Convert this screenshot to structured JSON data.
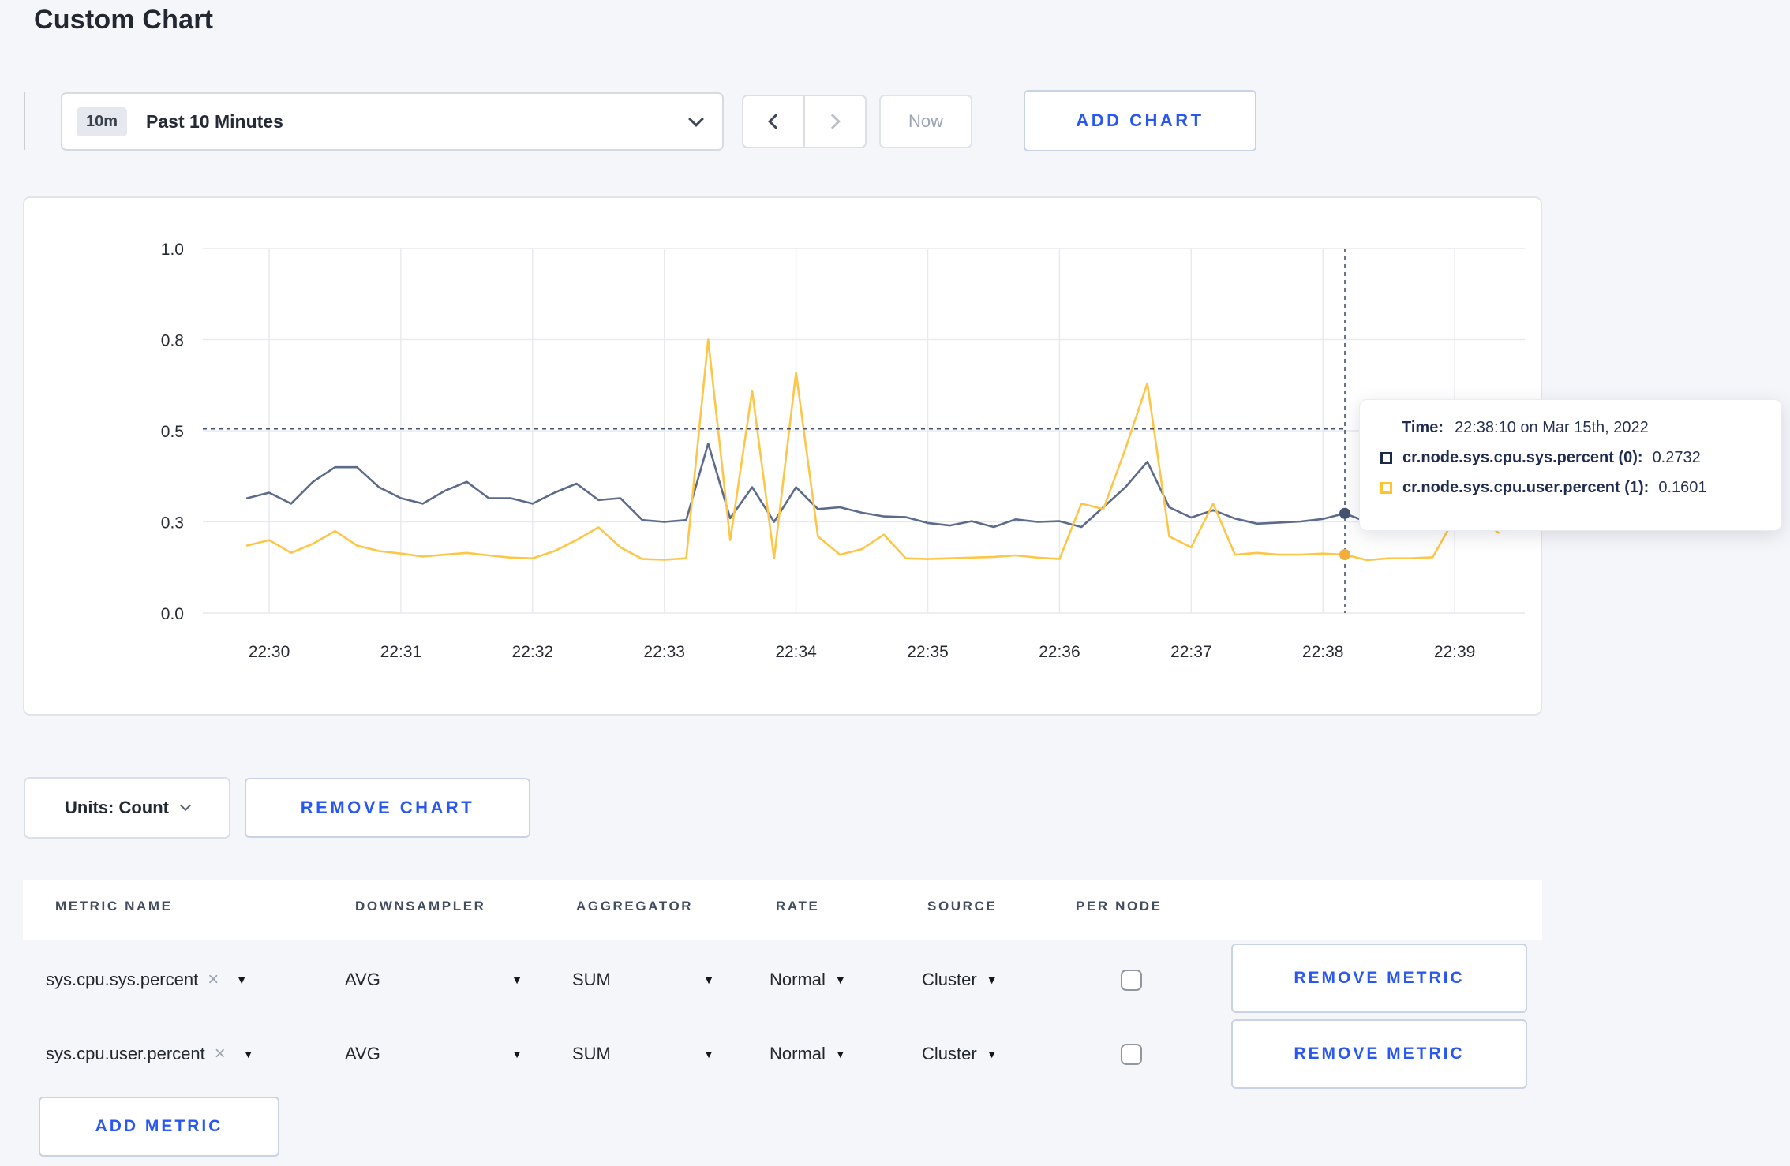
{
  "page": {
    "title": "Custom Chart"
  },
  "toolbar": {
    "time_badge": "10m",
    "time_label": "Past 10 Minutes",
    "now_label": "Now",
    "add_chart_label": "ADD CHART"
  },
  "colors": {
    "accent_blue": "#2a57f2",
    "series_sys": "#5c6b89",
    "series_user": "#fdc648",
    "crosshair": "#44536f",
    "page_bg": "#f5f6fa"
  },
  "chart_data": {
    "type": "line",
    "title": "",
    "xlabel": "",
    "ylabel": "",
    "ylim": [
      0,
      1
    ],
    "grid": true,
    "grid_color": "#e8eaee",
    "x_labels": [
      "22:30",
      "22:31",
      "22:32",
      "22:33",
      "22:34",
      "22:35",
      "22:36",
      "22:37",
      "22:38",
      "22:39"
    ],
    "step_min": 0.166667,
    "x_offset_steps": -1,
    "y_ticks": [
      {
        "v": 0.0,
        "label": "0.0"
      },
      {
        "v": 0.25,
        "label": "0.3"
      },
      {
        "v": 0.5,
        "label": "0.5"
      },
      {
        "v": 0.75,
        "label": "0.8"
      },
      {
        "v": 1.0,
        "label": "1.0"
      }
    ],
    "series": [
      {
        "name": "cr.node.sys.cpu.sys.percent",
        "color": "#5c6b89",
        "swatch_color": "#1c2a4a",
        "dot_color": "#44536f",
        "values": [
          0.315,
          0.33,
          0.3,
          0.36,
          0.4,
          0.4,
          0.345,
          0.315,
          0.3,
          0.335,
          0.36,
          0.315,
          0.315,
          0.3,
          0.33,
          0.355,
          0.31,
          0.315,
          0.255,
          0.25,
          0.255,
          0.465,
          0.26,
          0.345,
          0.25,
          0.345,
          0.285,
          0.29,
          0.275,
          0.265,
          0.263,
          0.247,
          0.24,
          0.252,
          0.236,
          0.257,
          0.25,
          0.252,
          0.236,
          0.29,
          0.345,
          0.415,
          0.29,
          0.262,
          0.282,
          0.259,
          0.245,
          0.248,
          0.251,
          0.258,
          0.2732,
          0.25,
          0.258,
          0.268,
          0.256,
          0.263,
          0.275,
          0.268
        ]
      },
      {
        "name": "cr.node.sys.cpu.user.percent",
        "color": "#fdc648",
        "swatch_color": "#ffc32f",
        "dot_color": "#f1ae38",
        "values": [
          0.185,
          0.2,
          0.165,
          0.19,
          0.225,
          0.185,
          0.17,
          0.163,
          0.155,
          0.16,
          0.165,
          0.158,
          0.152,
          0.15,
          0.17,
          0.2,
          0.235,
          0.18,
          0.148,
          0.146,
          0.15,
          0.75,
          0.2,
          0.61,
          0.15,
          0.66,
          0.21,
          0.16,
          0.175,
          0.215,
          0.15,
          0.148,
          0.15,
          0.152,
          0.154,
          0.158,
          0.152,
          0.148,
          0.3,
          0.285,
          0.45,
          0.63,
          0.21,
          0.18,
          0.3,
          0.16,
          0.165,
          0.16,
          0.16,
          0.163,
          0.1601,
          0.145,
          0.15,
          0.15,
          0.153,
          0.26,
          0.27,
          0.22
        ]
      }
    ],
    "crosshair": {
      "minute": 8.1667,
      "cursor_value": 0.505,
      "color": "#44536f",
      "points": [
        0.2732,
        0.1601
      ]
    }
  },
  "tooltip": {
    "time_label": "Time:",
    "time_value": "22:38:10 on Mar 15th, 2022",
    "rows": [
      {
        "name": "cr.node.sys.cpu.sys.percent (0):",
        "value": "0.2732"
      },
      {
        "name": "cr.node.sys.cpu.user.percent (1):",
        "value": "0.1601"
      }
    ]
  },
  "units": {
    "label": "Units: Count"
  },
  "chart_actions": {
    "remove_chart_label": "REMOVE CHART"
  },
  "table": {
    "headers": [
      "METRIC NAME",
      "DOWNSAMPLER",
      "AGGREGATOR",
      "RATE",
      "SOURCE",
      "PER NODE"
    ],
    "rows": [
      {
        "metric": "sys.cpu.sys.percent",
        "downsampler": "AVG",
        "aggregator": "SUM",
        "rate": "Normal",
        "source": "Cluster",
        "per_node_checked": false,
        "remove_label": "REMOVE METRIC"
      },
      {
        "metric": "sys.cpu.user.percent",
        "downsampler": "AVG",
        "aggregator": "SUM",
        "rate": "Normal",
        "source": "Cluster",
        "per_node_checked": false,
        "remove_label": "REMOVE METRIC"
      }
    ],
    "add_metric_label": "ADD METRIC"
  }
}
